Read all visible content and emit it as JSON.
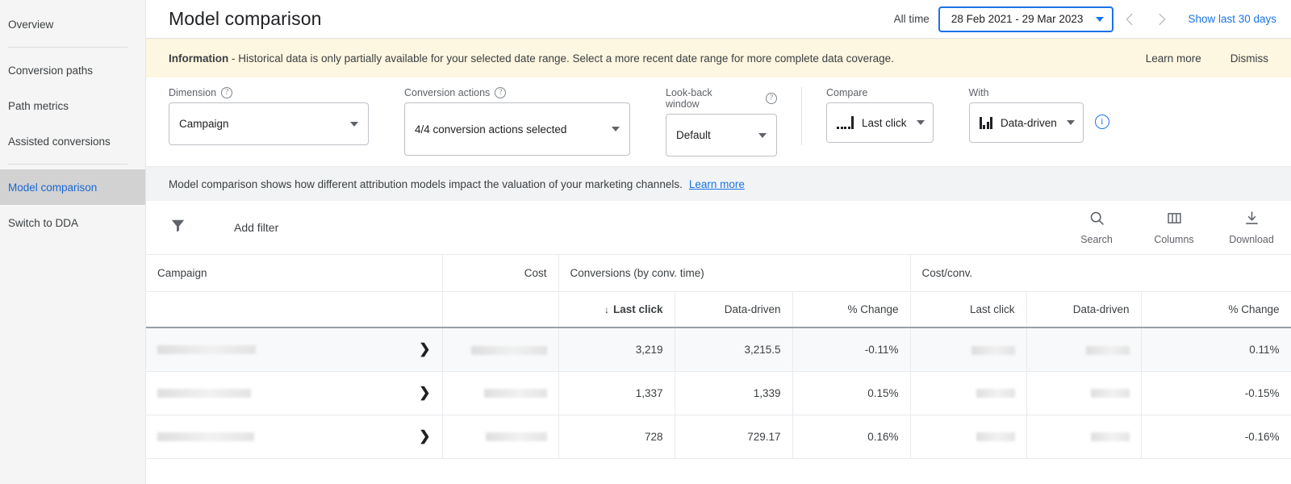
{
  "sidebar": {
    "items": [
      {
        "label": "Overview",
        "active": false
      },
      {
        "label": "Conversion paths",
        "active": false
      },
      {
        "label": "Path metrics",
        "active": false
      },
      {
        "label": "Assisted conversions",
        "active": false
      },
      {
        "label": "Model comparison",
        "active": true
      },
      {
        "label": "Switch to DDA",
        "active": false
      }
    ]
  },
  "header": {
    "title": "Model comparison",
    "all_time_label": "All time",
    "date_range": "28 Feb 2021 - 29 Mar 2023",
    "prev_icon": "chevron-left-icon",
    "next_icon": "chevron-right-icon",
    "show_last_30": "Show last 30 days"
  },
  "banner": {
    "strong": "Information",
    "text": "- Historical data is only partially available for your selected date range. Select a more recent date range for more complete data coverage.",
    "learn_more": "Learn more",
    "dismiss": "Dismiss"
  },
  "controls": {
    "dimension": {
      "label": "Dimension",
      "value": "Campaign"
    },
    "conversion_actions": {
      "label": "Conversion actions",
      "value": "4/4 conversion actions selected"
    },
    "lookback": {
      "label": "Look-back window",
      "value": "Default"
    },
    "compare": {
      "label": "Compare",
      "value": "Last click",
      "icon": "last-click-bars-icon"
    },
    "with": {
      "label": "With",
      "value": "Data-driven",
      "icon": "data-driven-bars-icon"
    }
  },
  "description": {
    "text": "Model comparison shows how different attribution models impact the valuation of your marketing channels.",
    "link": "Learn more"
  },
  "toolbar": {
    "add_filter": "Add filter",
    "search": "Search",
    "columns": "Columns",
    "download": "Download"
  },
  "table": {
    "group_headers": [
      {
        "label": "Campaign",
        "align": "left"
      },
      {
        "label": "Cost",
        "align": "right"
      },
      {
        "label": "Conversions (by conv. time)",
        "align": "left"
      },
      {
        "label": "Cost/conv.",
        "align": "left"
      }
    ],
    "sub_headers": [
      "",
      "",
      "Last click",
      "Data-driven",
      "% Change",
      "Last click",
      "Data-driven",
      "% Change"
    ],
    "sorted_column": "Last click",
    "sort_direction": "desc",
    "rows": [
      {
        "campaign": "",
        "cost": "",
        "conv_last_click": "3,219",
        "conv_data_driven": "3,215.5",
        "conv_change": "-0.11%",
        "cpc_last_click": "",
        "cpc_data_driven": "",
        "cpc_change": "0.11%"
      },
      {
        "campaign": "",
        "cost": "",
        "conv_last_click": "1,337",
        "conv_data_driven": "1,339",
        "conv_change": "0.15%",
        "cpc_last_click": "",
        "cpc_data_driven": "",
        "cpc_change": "-0.15%"
      },
      {
        "campaign": "",
        "cost": "",
        "conv_last_click": "728",
        "conv_data_driven": "729.17",
        "conv_change": "0.16%",
        "cpc_last_click": "",
        "cpc_data_driven": "",
        "cpc_change": "-0.16%"
      }
    ]
  },
  "colors": {
    "accent": "#1a73e8",
    "banner_bg": "#fdf6e0",
    "sidebar_bg": "#f5f5f5",
    "active_nav_bg": "#d2d2d2"
  }
}
